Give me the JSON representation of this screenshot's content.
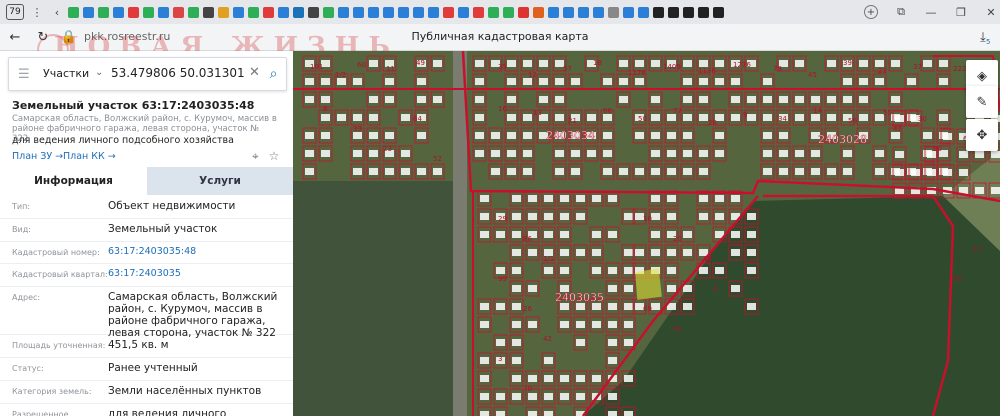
{
  "browser": {
    "tab_count": "79",
    "url": "pkk.rosreestr.ru",
    "page_title": "Публичная кадастровая карта",
    "notification_badge": "5"
  },
  "watermark": {
    "text": "НОВАЯ ЖИЗНЬ"
  },
  "search": {
    "category": "Участки",
    "query": "53.479806 50.031301"
  },
  "parcel": {
    "title": "Земельный участок 63:17:2403035:48",
    "address_short": "Самарская область, Волжский район, с. Курумоч, массив в районе фабричного гаража, левая сторона, участок № 322",
    "purpose": "для ведения личного подсобного хозяйства",
    "plan_zu": "План ЗУ →",
    "plan_kk": "План КК →"
  },
  "tabs": {
    "info": "Информация",
    "services": "Услуги"
  },
  "info_rows": [
    {
      "label": "Тип:",
      "value": "Объект недвижимости",
      "link": false
    },
    {
      "label": "Вид:",
      "value": "Земельный участок",
      "link": false
    },
    {
      "label": "Кадастровый номер:",
      "value": "63:17:2403035:48",
      "link": true
    },
    {
      "label": "Кадастровый квартал:",
      "value": "63:17:2403035",
      "link": true
    },
    {
      "label": "Адрес:",
      "value": "Самарская область, Волжский район, с. Курумоч, массив в районе фабричного гаража, левая сторона, участок № 322",
      "link": false
    },
    {
      "label": "Площадь уточненная:",
      "value": "451,5 кв. м",
      "link": false
    },
    {
      "label": "Статус:",
      "value": "Ранее учтенный",
      "link": false
    },
    {
      "label": "Категория земель:",
      "value": "Земли населённых пунктов",
      "link": false
    },
    {
      "label": "Разрешенное",
      "value": "для ведения личного подсобного",
      "link": false
    }
  ],
  "map": {
    "quarters": [
      "2403034",
      "2403028",
      "2403035"
    ],
    "parcel_numbers": [
      "101",
      "1/2",
      "60",
      "11",
      "49",
      "35",
      "12",
      "57",
      "18",
      "1176",
      "1409",
      "1130",
      "1276",
      "78",
      "45",
      "39",
      "21",
      "37",
      "2227",
      "16",
      "13",
      "21",
      "66",
      "50",
      "77",
      "28",
      "9",
      "34",
      "14",
      "56",
      "55",
      "30",
      "29",
      "86",
      "1/1",
      "99",
      "26",
      "42",
      "3",
      "70",
      "10",
      "20",
      "48",
      "69",
      "41",
      "4",
      "42",
      "90",
      "62",
      "27",
      "17",
      "8",
      "33",
      "23",
      "64",
      "52"
    ],
    "colors": {
      "boundary": "#c8102e",
      "selected": "#e6e632",
      "forest": "#2f4a2c",
      "field": "#6f7f55"
    }
  }
}
